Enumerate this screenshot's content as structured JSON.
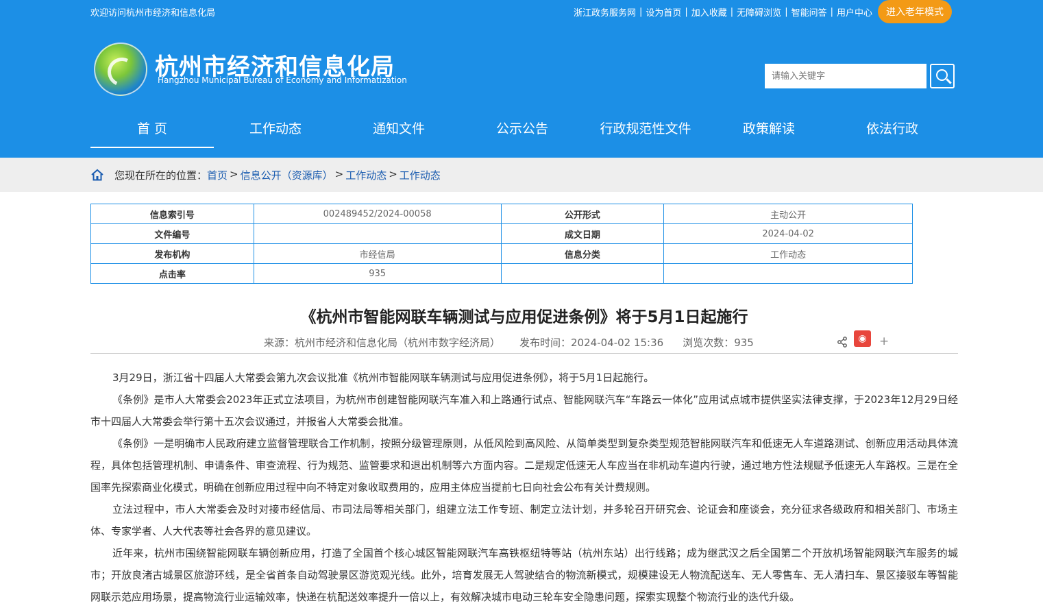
{
  "topbar": {
    "welcome": "欢迎访问杭州市经济和信息化局",
    "links": [
      "浙江政务服务网",
      "设为首页",
      "加入收藏",
      "无障碍浏览",
      "智能问答",
      "用户中心"
    ],
    "elder_mode": "进入老年模式"
  },
  "site": {
    "title": "杭州市经济和信息化局",
    "subtitle": "Hangzhou Municipal Bureau of Economy and Informatization"
  },
  "search": {
    "placeholder": "请输入关键字"
  },
  "nav": [
    "首 页",
    "工作动态",
    "通知文件",
    "公示公告",
    "行政规范性文件",
    "政策解读",
    "依法行政"
  ],
  "breadcrumb": {
    "prefix": "您现在所在的位置：",
    "items": [
      "首页",
      "信息公开（资源库）",
      "工作动态",
      "工作动态"
    ],
    "separators": [
      ">",
      ">",
      ">"
    ]
  },
  "info": {
    "rows": [
      [
        "信息索引号",
        "002489452/2024-00058",
        "公开形式",
        "主动公开"
      ],
      [
        "文件编号",
        "",
        "成文日期",
        "2024-04-02"
      ],
      [
        "发布机构",
        "市经信局",
        "信息分类",
        "工作动态"
      ],
      [
        "点击率",
        "935",
        "",
        ""
      ]
    ]
  },
  "article": {
    "title": "《杭州市智能网联车辆测试与应用促进条例》将于5月1日起施行",
    "source": "来源：杭州市经济和信息化局（杭州市数字经济局）",
    "publish_time": "发布时间：2024-04-02 15:36",
    "views": "浏览次数：935",
    "paragraphs": [
      "3月29日，浙江省十四届人大常委会第九次会议批准《杭州市智能网联车辆测试与应用促进条例》，将于5月1日起施行。",
      "《条例》是市人大常委会2023年正式立法项目，为杭州市创建智能网联汽车准入和上路通行试点、智能网联汽车“车路云一体化”应用试点城市提供坚实法律支撑，于2023年12月29日经市十四届人大常委会举行第十五次会议通过，并报省人大常委会批准。",
      "《条例》一是明确市人民政府建立监督管理联合工作机制，按照分级管理原则，从低风险到高风险、从简单类型到复杂类型规范智能网联汽车和低速无人车道路测试、创新应用活动具体流程，具体包括管理机制、申请条件、审查流程、行为规范、监管要求和退出机制等六方面内容。二是规定低速无人车应当在非机动车道内行驶，通过地方性法规赋予低速无人车路权。三是在全国率先探索商业化模式，明确在创新应用过程中向不特定对象收取费用的，应用主体应当提前七日向社会公布有关计费规则。",
      "立法过程中，市人大常委会及时对接市经信局、市司法局等相关部门，组建立法工作专班、制定立法计划，并多轮召开研究会、论证会和座谈会，充分征求各级政府和相关部门、市场主体、专家学者、人大代表等社会各界的意见建议。",
      "近年来，杭州市围绕智能网联车辆创新应用，打造了全国首个核心城区智能网联汽车高铁枢纽特等站（杭州东站）出行线路；成为继武汉之后全国第二个开放机场智能网联汽车服务的城市；开放良渚古城景区旅游环线，是全省首条自动驾驶景区游览观光线。此外，培育发展无人驾驶结合的物流新模式，规模建设无人物流配送车、无人零售车、无人清扫车、景区接驳车等智能网联示范应用场景，提高物流行业运输效率，快递在杭配送效率提升一倍以上，有效解决城市电动三轮车安全隐患问题，探索实现整个物流行业的迭代升级。"
    ]
  },
  "colors": {
    "header_blue": "#1c8fe6",
    "elder_orange": "#f39a16",
    "weibo_red": "#e8463c"
  }
}
